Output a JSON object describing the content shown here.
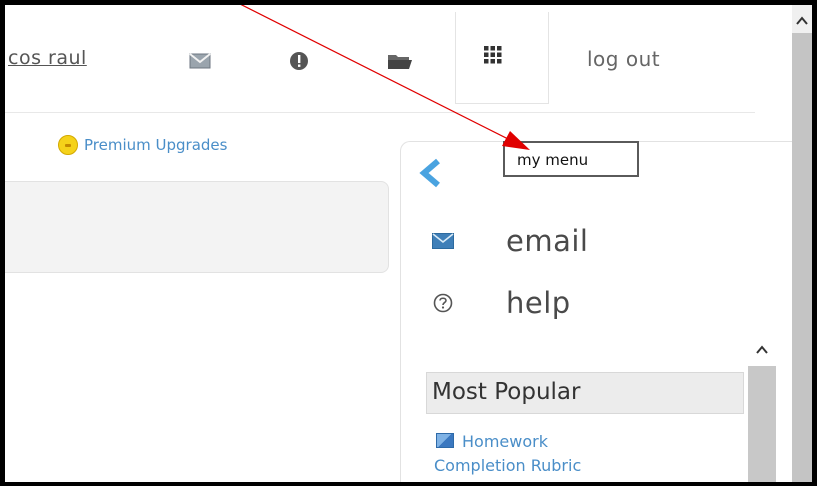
{
  "header": {
    "user_name": "cos raul",
    "icons": [
      "mail-icon",
      "alert-icon",
      "folder-icon",
      "grid-menu-icon"
    ],
    "logout_label": "log out"
  },
  "content": {
    "premium_label": "Premium Upgrades"
  },
  "side_menu": {
    "items": [
      {
        "label": "email",
        "icon": "mail-icon"
      },
      {
        "label": "help",
        "icon": "help-icon"
      }
    ],
    "most_popular": {
      "heading": "Most Popular",
      "link_line1": "Homework",
      "link_line2": "Completion Rubric"
    }
  },
  "tooltip": {
    "text": "my menu"
  },
  "colors": {
    "link_blue": "#4a8ec8",
    "annotation_red": "#e00000",
    "coin_yellow": "#f5d21a"
  }
}
